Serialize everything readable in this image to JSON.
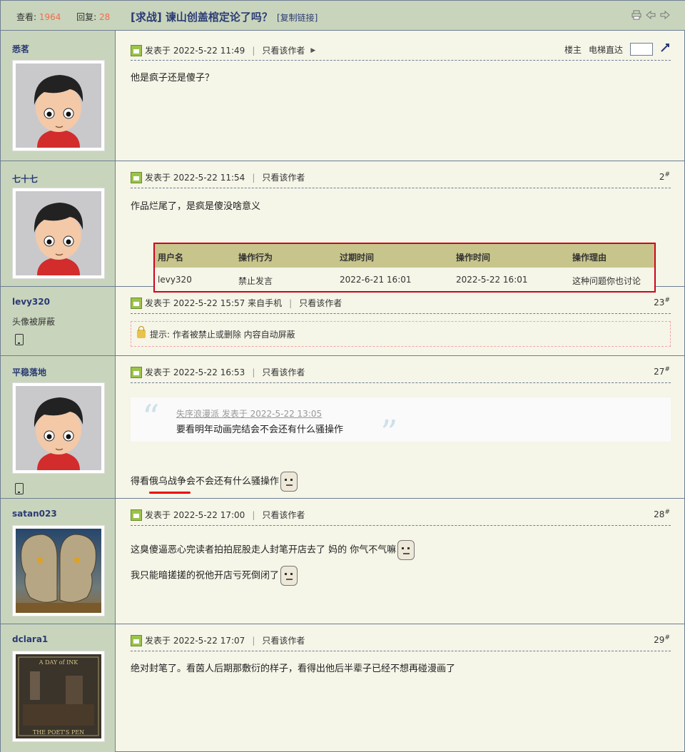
{
  "header": {
    "views_label": "查看:",
    "views": "1964",
    "replies_label": "回复:",
    "replies": "28",
    "title": "[求战] 谏山创盖棺定论了吗？",
    "copy_link": "[复制链接]"
  },
  "posts": [
    {
      "author": "悉茗",
      "posted": "发表于 2022-5-22 11:49",
      "only_author": "只看该作者",
      "floor_label": "楼主",
      "elevator": "电梯直达",
      "content": "他是疯子还是傻子？"
    },
    {
      "author": "七十七",
      "posted": "发表于 2022-5-22 11:54",
      "only_author": "只看该作者",
      "floor": "2",
      "content": "作品烂尾了，是疯是傻没啥意义",
      "mod_headers": [
        "用户名",
        "操作行为",
        "过期时间",
        "操作时间",
        "操作理由"
      ],
      "mod_row": [
        "levy320",
        "禁止发言",
        "2022-6-21 16:01",
        "2022-5-22 16:01",
        "这种问题你也讨论"
      ]
    },
    {
      "author": "levy320",
      "author_note": "头像被屏蔽",
      "posted": "发表于 2022-5-22 15:57 来自手机",
      "only_author": "只看该作者",
      "floor": "23",
      "notice": "提示: 作者被禁止或删除 内容自动屏蔽"
    },
    {
      "author": "平稳落地",
      "posted": "发表于 2022-5-22 16:53",
      "only_author": "只看该作者",
      "floor": "27",
      "quote_src": "失序浪漫派 发表于 2022-5-22 13:05",
      "quote_text": "要看明年动画完结会不会还有什么骚操作",
      "content": "得看俄乌战争会不会还有什么骚操作"
    },
    {
      "author": "satan023",
      "posted": "发表于 2022-5-22 17:00",
      "only_author": "只看该作者",
      "floor": "28",
      "content_1": "这臭傻逼恶心完读者拍拍屁股走人封笔开店去了 妈的 你气不气嘛",
      "content_2": "我只能暗搓搓的祝他开店亏死倒闭了"
    },
    {
      "author": "dclara1",
      "posted": "发表于 2022-5-22 17:07",
      "only_author": "只看该作者",
      "floor": "29",
      "content": "绝对封笔了。看茵人后期那敷衍的样子，看得出他后半辈子已经不想再碰漫画了",
      "avatar_caption_top": "A DAY of INK",
      "avatar_caption_bottom": "THE POET'S PEN"
    }
  ],
  "floor_mark": "#",
  "quote_open": "“",
  "quote_close": "”"
}
